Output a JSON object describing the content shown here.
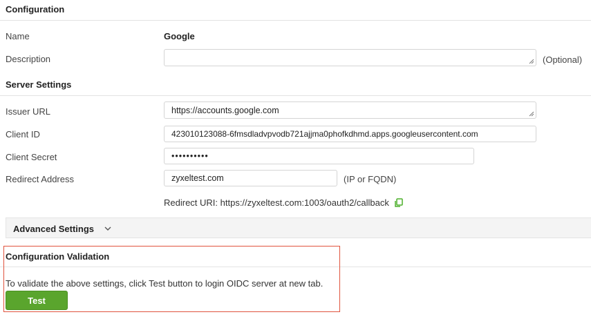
{
  "configuration": {
    "title": "Configuration",
    "name_label": "Name",
    "name_value": "Google",
    "description_label": "Description",
    "description_value": "",
    "description_hint": "(Optional)"
  },
  "server_settings": {
    "title": "Server Settings",
    "issuer_url_label": "Issuer URL",
    "issuer_url_value": "https://accounts.google.com",
    "client_id_label": "Client ID",
    "client_id_value": "423010123088-6fmsdladvpvodb721ajjma0phofkdhmd.apps.googleusercontent.com",
    "client_secret_label": "Client Secret",
    "client_secret_value": "••••••••••",
    "redirect_address_label": "Redirect Address",
    "redirect_address_value": "zyxeltest.com",
    "redirect_address_hint": "(IP or FQDN)",
    "redirect_uri_text": "Redirect URI: https://zyxeltest.com:1003/oauth2/callback"
  },
  "advanced_settings": {
    "label": "Advanced Settings",
    "icon": "chevron-down-icon"
  },
  "validation": {
    "title": "Configuration Validation",
    "description": "To validate the above settings, click Test button to login OIDC server at new tab.",
    "test_label": "Test"
  },
  "colors": {
    "accent_green": "#5aa52d",
    "highlight_red": "#e0523c"
  }
}
